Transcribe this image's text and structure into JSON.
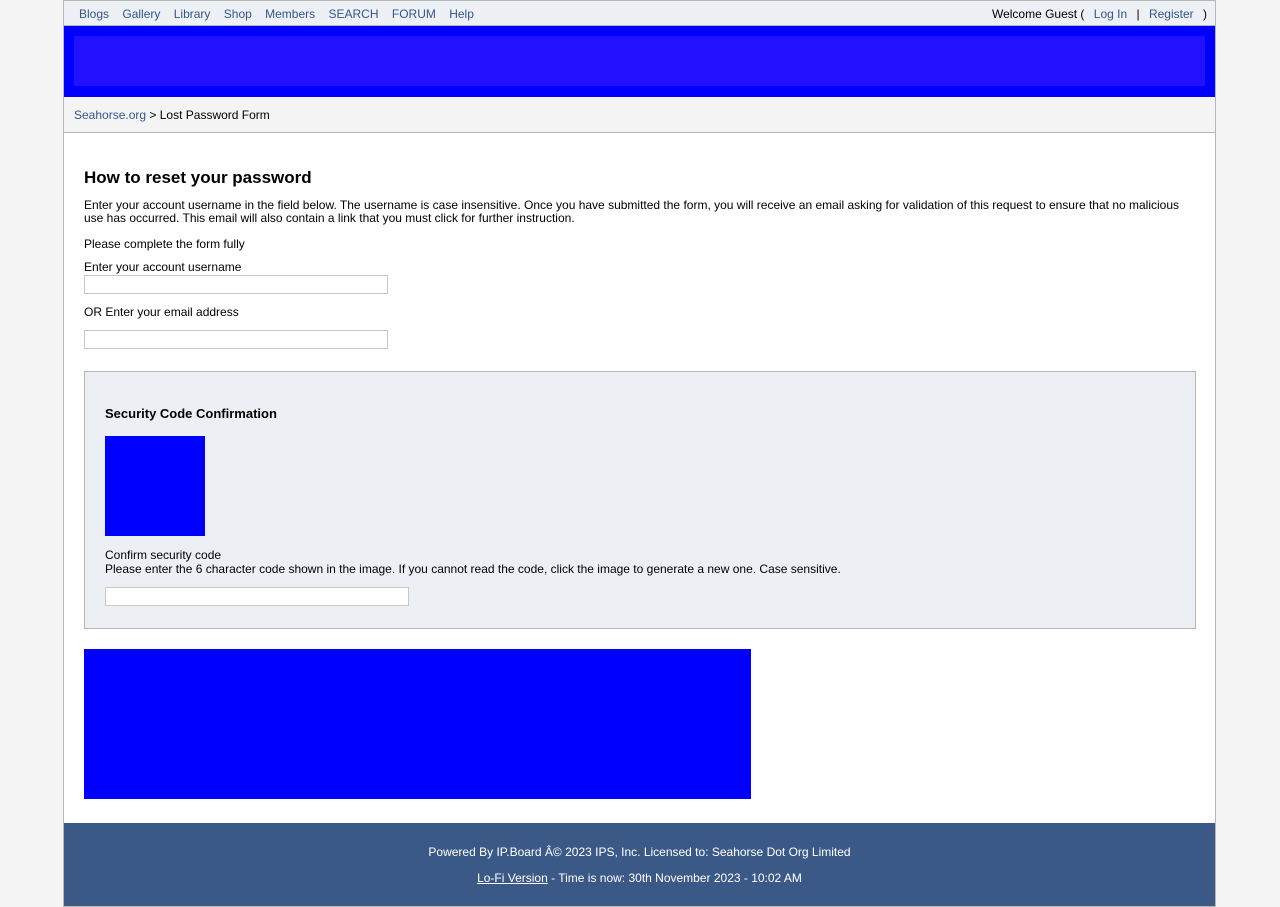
{
  "nav": {
    "links": [
      "Blogs",
      "Gallery",
      "Library",
      "Shop",
      "Members",
      "SEARCH",
      "FORUM",
      "Help"
    ],
    "welcome": "Welcome Guest (",
    "login": "Log In",
    "sep": "|",
    "register": "Register",
    "close": ")"
  },
  "breadcrumb": {
    "home": "Seahorse.org",
    "sep": ">",
    "current": "Lost Password Form"
  },
  "form": {
    "title": "How to reset your password",
    "intro": "Enter your account username in the field below. The username is case insensitive. Once you have submitted the form, you will receive an email asking for validation of this request to ensure that no malicious use has occurred. This email will also contain a link that you must click for further instruction.",
    "complete": "Please complete the form fully",
    "username_label": "Enter your account username",
    "email_label": "OR Enter your email address",
    "security": {
      "title": "Security Code Confirmation",
      "confirm_label": "Confirm security code",
      "confirm_desc": "Please enter the 6 character code shown in the image. If you cannot read the code, click the image to generate a new one. Case sensitive."
    }
  },
  "footer": {
    "powered": "Powered By IP.Board Â© 2023 IPS, Inc. Licensed to: Seahorse Dot Org Limited",
    "lofi": "Lo-Fi Version",
    "time": " - Time is now: 30th November 2023 - 10:02 AM"
  },
  "colors": {
    "accent": "#3a5987",
    "link": "#34558a",
    "banner": "#0000ff"
  }
}
